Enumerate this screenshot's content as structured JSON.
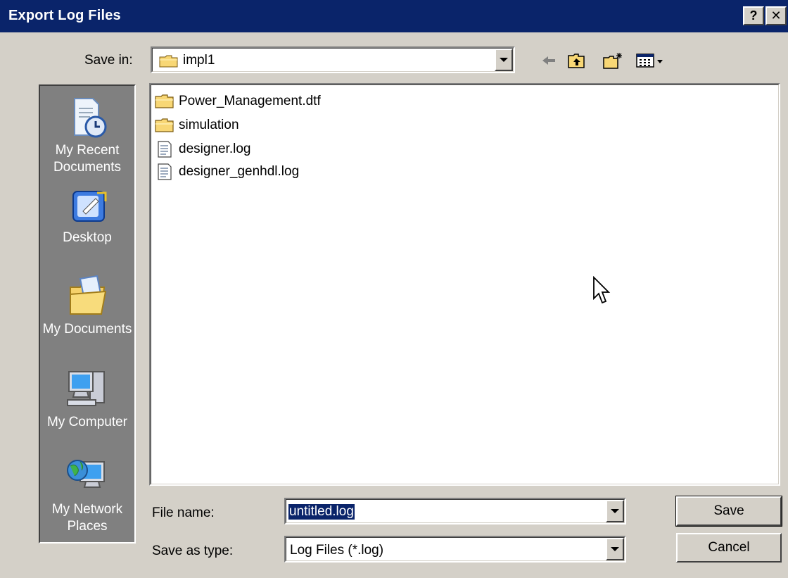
{
  "dialog": {
    "title": "Export Log Files",
    "help_button": "?",
    "close_button": "✕"
  },
  "save_in": {
    "label": "Save in:",
    "value": "impl1"
  },
  "toolbar": {
    "icons": [
      "back-arrow-icon",
      "up-folder-icon",
      "new-folder-icon",
      "view-menu-icon"
    ]
  },
  "places": [
    {
      "label_line1": "My Recent",
      "label_line2": "Documents",
      "icon": "recent-documents-icon"
    },
    {
      "label_line1": "Desktop",
      "label_line2": "",
      "icon": "desktop-icon"
    },
    {
      "label_line1": "My Documents",
      "label_line2": "",
      "icon": "my-documents-icon"
    },
    {
      "label_line1": "My Computer",
      "label_line2": "",
      "icon": "my-computer-icon"
    },
    {
      "label_line1": "My Network",
      "label_line2": "Places",
      "icon": "network-places-icon"
    }
  ],
  "files": [
    {
      "name": "Power_Management.dtf",
      "kind": "folder"
    },
    {
      "name": "simulation",
      "kind": "folder"
    },
    {
      "name": "designer.log",
      "kind": "file"
    },
    {
      "name": "designer_genhdl.log",
      "kind": "file"
    }
  ],
  "form": {
    "file_name_label": "File name:",
    "file_name_value": "untitled.log",
    "save_as_type_label": "Save as type:",
    "save_as_type_value": "Log Files (*.log)"
  },
  "buttons": {
    "save": "Save",
    "cancel": "Cancel"
  },
  "colors": {
    "titlebar": "#0a246a",
    "face": "#d4d0c8",
    "places_bg": "#808080",
    "selection": "#0a246a"
  }
}
